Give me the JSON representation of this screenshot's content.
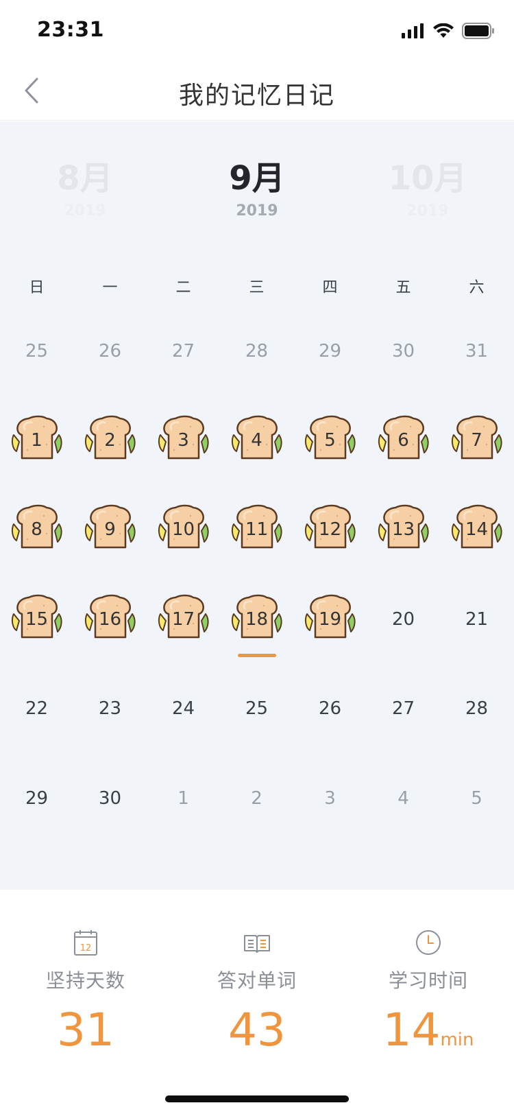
{
  "status": {
    "time": "23:31"
  },
  "nav": {
    "title": "我的记忆日记"
  },
  "months": {
    "prev": {
      "name": "8月",
      "year": "2019"
    },
    "current": {
      "name": "9月",
      "year": "2019"
    },
    "next": {
      "name": "10月",
      "year": "2019"
    }
  },
  "weekdays": [
    "日",
    "一",
    "二",
    "三",
    "四",
    "五",
    "六"
  ],
  "calendar": {
    "rows": [
      [
        {
          "n": "25",
          "t": "other"
        },
        {
          "n": "26",
          "t": "other"
        },
        {
          "n": "27",
          "t": "other"
        },
        {
          "n": "28",
          "t": "other"
        },
        {
          "n": "29",
          "t": "other"
        },
        {
          "n": "30",
          "t": "other"
        },
        {
          "n": "31",
          "t": "other"
        }
      ],
      [
        {
          "n": "1",
          "t": "marked"
        },
        {
          "n": "2",
          "t": "marked"
        },
        {
          "n": "3",
          "t": "marked"
        },
        {
          "n": "4",
          "t": "marked"
        },
        {
          "n": "5",
          "t": "marked"
        },
        {
          "n": "6",
          "t": "marked"
        },
        {
          "n": "7",
          "t": "marked"
        }
      ],
      [
        {
          "n": "8",
          "t": "marked"
        },
        {
          "n": "9",
          "t": "marked"
        },
        {
          "n": "10",
          "t": "marked"
        },
        {
          "n": "11",
          "t": "marked"
        },
        {
          "n": "12",
          "t": "marked"
        },
        {
          "n": "13",
          "t": "marked"
        },
        {
          "n": "14",
          "t": "marked"
        }
      ],
      [
        {
          "n": "15",
          "t": "marked"
        },
        {
          "n": "16",
          "t": "marked"
        },
        {
          "n": "17",
          "t": "marked"
        },
        {
          "n": "18",
          "t": "marked",
          "today": true
        },
        {
          "n": "19",
          "t": "marked"
        },
        {
          "n": "20",
          "t": "normal"
        },
        {
          "n": "21",
          "t": "normal"
        }
      ],
      [
        {
          "n": "22",
          "t": "normal"
        },
        {
          "n": "23",
          "t": "normal"
        },
        {
          "n": "24",
          "t": "normal"
        },
        {
          "n": "25",
          "t": "normal"
        },
        {
          "n": "26",
          "t": "normal"
        },
        {
          "n": "27",
          "t": "normal"
        },
        {
          "n": "28",
          "t": "normal"
        }
      ],
      [
        {
          "n": "29",
          "t": "normal"
        },
        {
          "n": "30",
          "t": "normal"
        },
        {
          "n": "1",
          "t": "other"
        },
        {
          "n": "2",
          "t": "other"
        },
        {
          "n": "3",
          "t": "other"
        },
        {
          "n": "4",
          "t": "other"
        },
        {
          "n": "5",
          "t": "other"
        }
      ]
    ]
  },
  "stats": {
    "days": {
      "label": "坚持天数",
      "value": "31",
      "icon": "calendar-icon",
      "icon_text": "12"
    },
    "words": {
      "label": "答对单词",
      "value": "43",
      "icon": "book-icon"
    },
    "time": {
      "label": "学习时间",
      "value": "14",
      "unit": "min",
      "icon": "clock-icon"
    }
  },
  "colors": {
    "accent": "#f0953f",
    "calendar_bg": "#f1f4f8",
    "toast": "#f6cfa4"
  }
}
